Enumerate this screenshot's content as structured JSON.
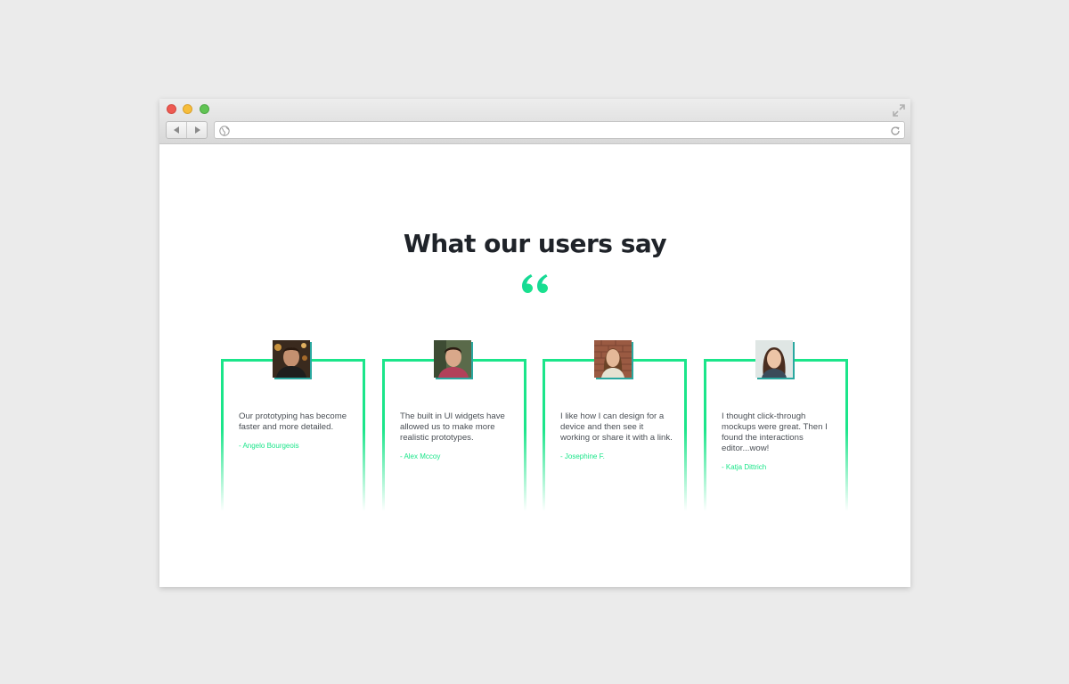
{
  "browser": {
    "address": ""
  },
  "section": {
    "title": "What our users say",
    "accent_color": "#1be58a"
  },
  "testimonials": [
    {
      "quote": "Our prototyping has become faster and more detailed.",
      "author": "- Angelo Bourgeois"
    },
    {
      "quote": "The built in UI widgets have allowed us to make more realistic prototypes.",
      "author": "- Alex Mccoy"
    },
    {
      "quote": "I like how I can design for a device and then see it working or share it with a link.",
      "author": "- Josephine F."
    },
    {
      "quote": "I thought click-through mockups were great. Then I found the interactions editor...wow!",
      "author": "- Katja Dittrich"
    }
  ]
}
